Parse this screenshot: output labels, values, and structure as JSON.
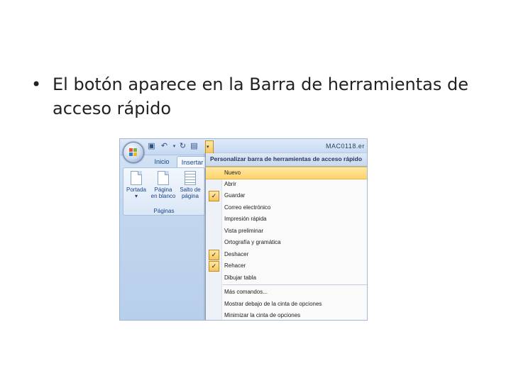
{
  "slide": {
    "bullet": "•",
    "text": "El botón aparece en la Barra de herramientas de acceso rápido"
  },
  "window": {
    "title": "MAC0118.er"
  },
  "ribbon": {
    "tabs": [
      {
        "label": "Inicio"
      },
      {
        "label": "Insertar"
      }
    ],
    "group_label": "Páginas",
    "buttons": [
      {
        "label": "Portada",
        "sub": "▾"
      },
      {
        "label": "Página",
        "sub": "en blanco"
      },
      {
        "label": "Salto de",
        "sub": "página"
      }
    ]
  },
  "qat": {
    "icons": [
      "save-icon",
      "undo-icon",
      "redo-icon",
      "customize-dropdown-icon"
    ],
    "drop_glyph": "▾"
  },
  "menu": {
    "header": "Personalizar barra de herramientas de acceso rápido",
    "check_glyph": "✓",
    "items": [
      {
        "label": "Nuevo",
        "checked": false,
        "highlighted": true
      },
      {
        "label": "Abrir",
        "checked": false
      },
      {
        "label": "Guardar",
        "checked": true
      },
      {
        "label": "Correo electrónico",
        "checked": false
      },
      {
        "label": "Impresión rápida",
        "checked": false
      },
      {
        "label": "Vista preliminar",
        "checked": false
      },
      {
        "label": "Ortografía y gramática",
        "checked": false
      },
      {
        "label": "Deshacer",
        "checked": true
      },
      {
        "label": "Rehacer",
        "checked": true
      },
      {
        "label": "Dibujar tabla",
        "checked": false
      },
      {
        "label": "Más comandos...",
        "checked": false
      },
      {
        "label": "Mostrar debajo de la cinta de opciones",
        "checked": false
      },
      {
        "label": "Minimizar la cinta de opciones",
        "checked": false
      }
    ]
  }
}
